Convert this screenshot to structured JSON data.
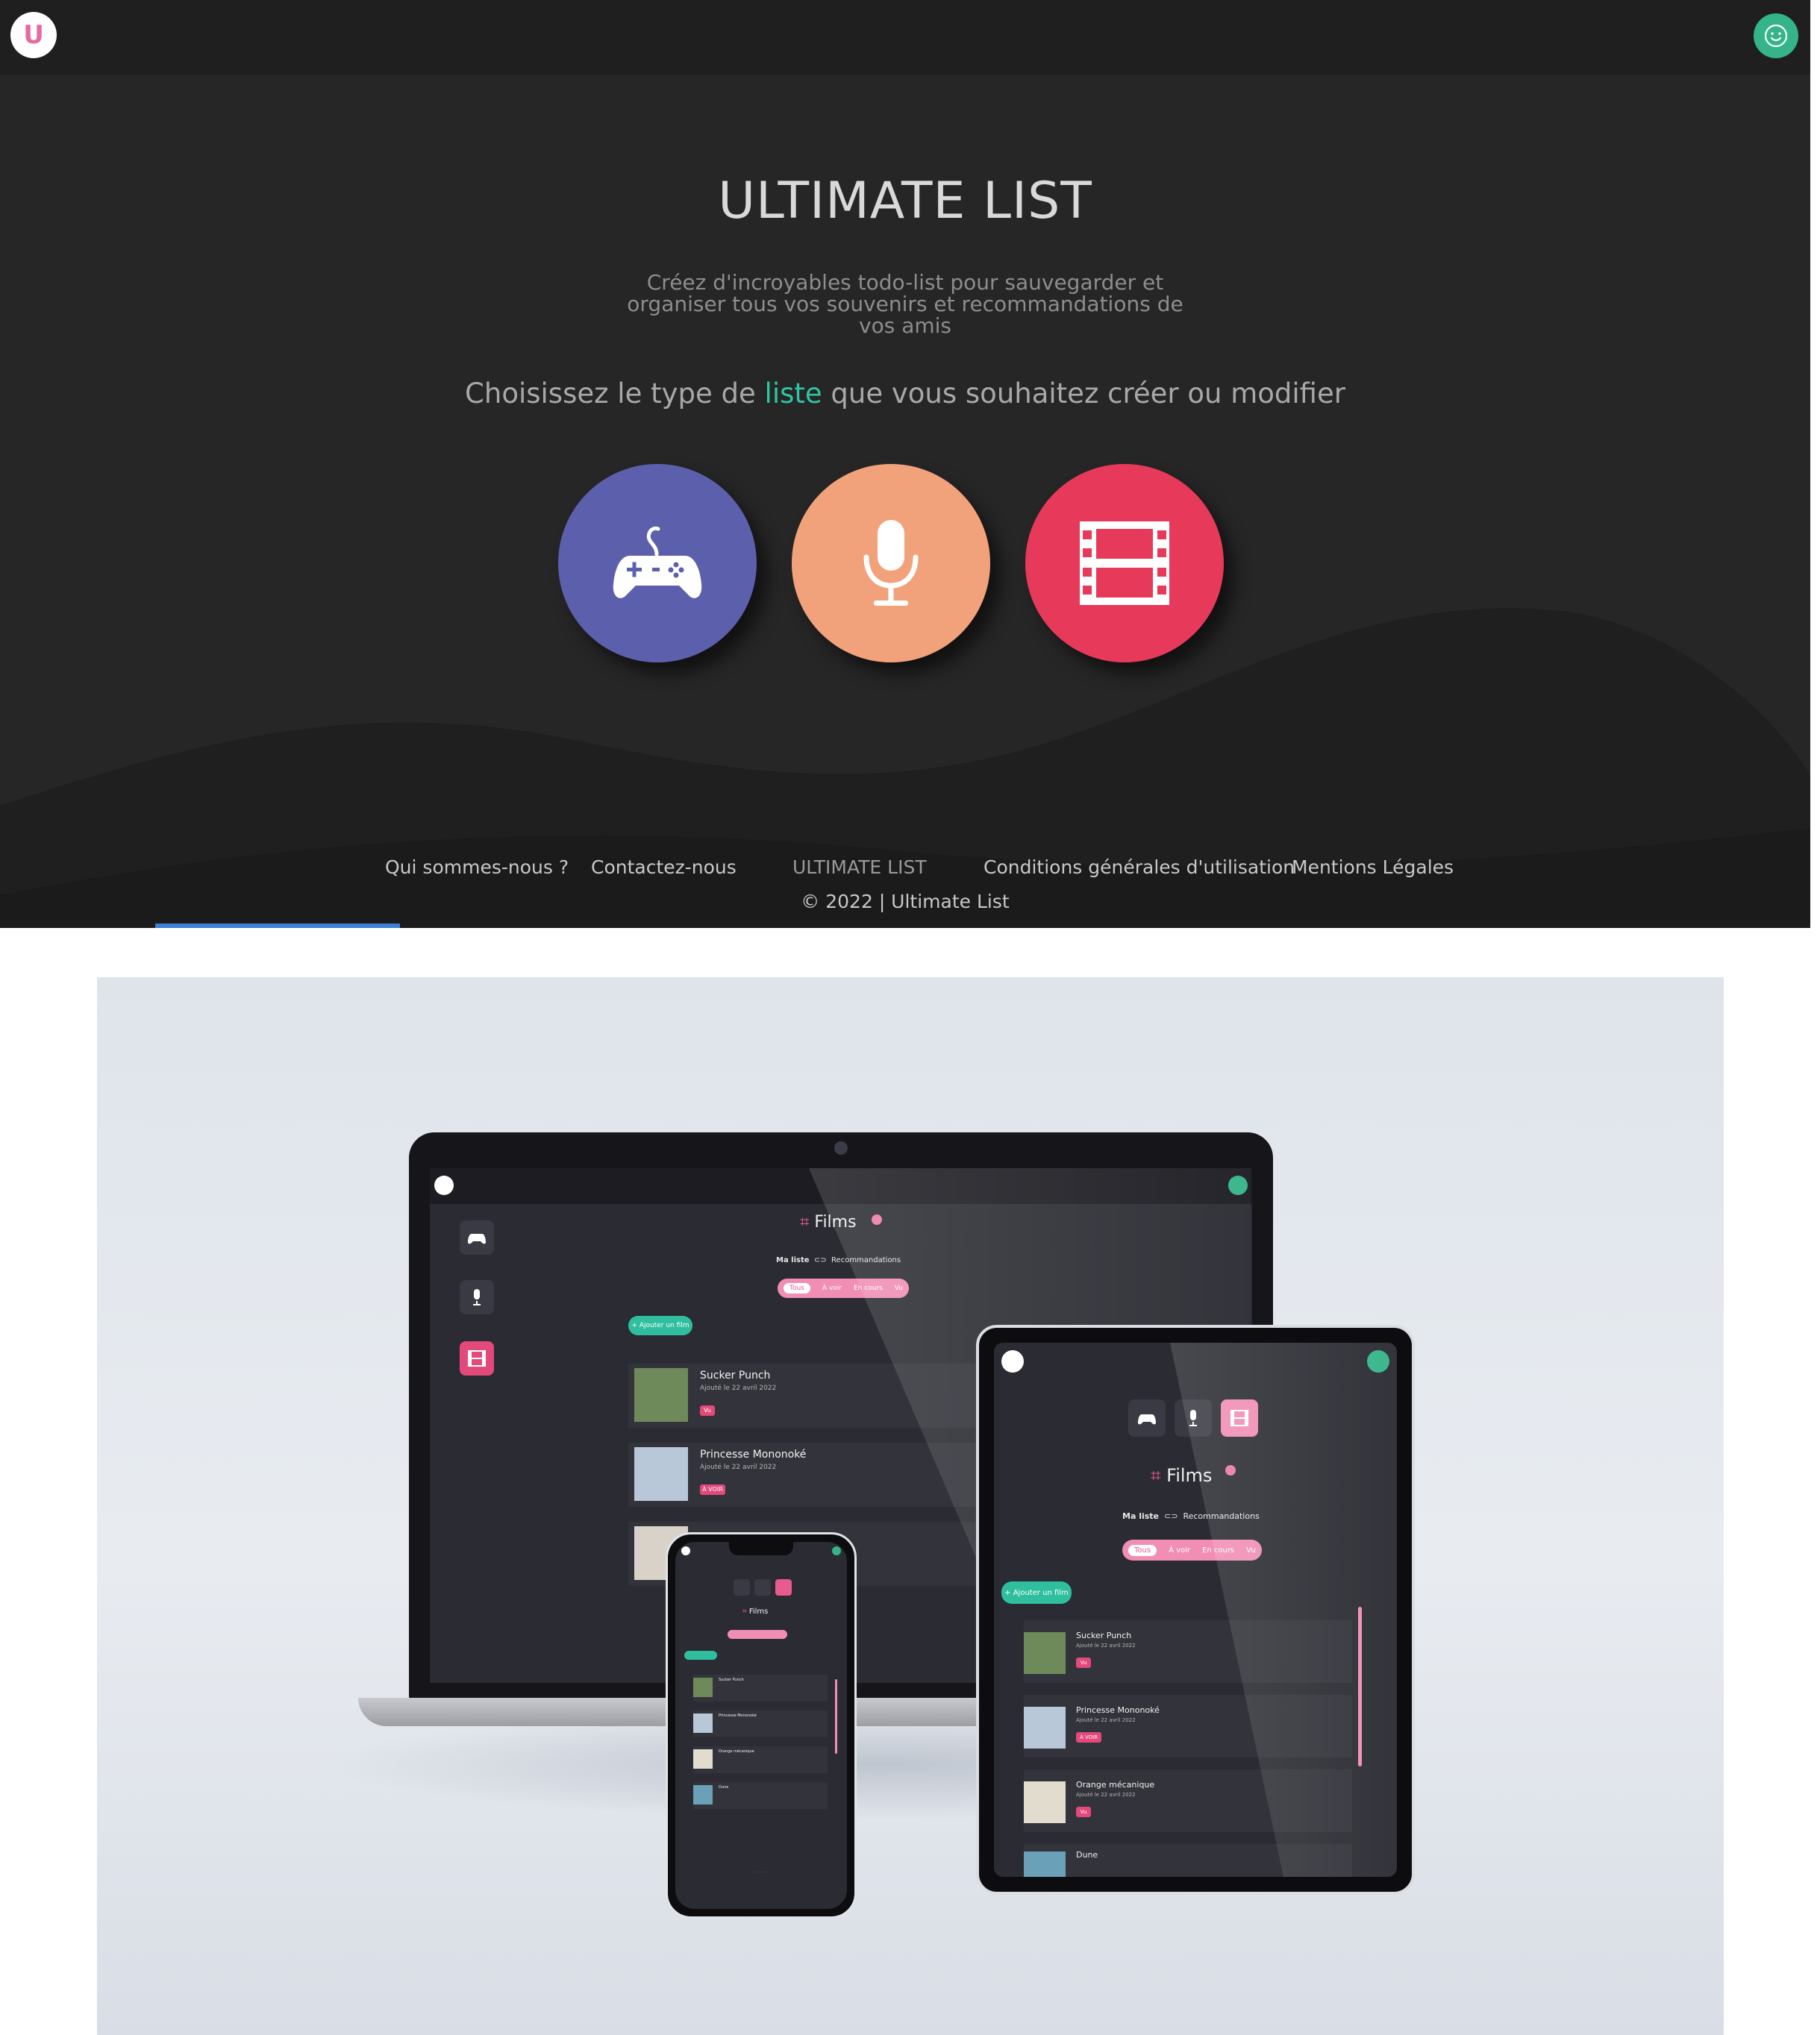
{
  "app": {
    "logo_letter": "U",
    "title": "ULTIMATE LIST",
    "description": "Créez d'incroyables todo-list pour sauvegarder et organiser tous vos souvenirs et recommandations de vos amis",
    "choose_prefix": "Choisissez le type de ",
    "choose_accent": "liste",
    "choose_suffix": " que vous souhaitez créer ou modifier",
    "type_buttons": [
      {
        "name": "gamepad-icon",
        "color": "#5c5fac"
      },
      {
        "name": "microphone-icon",
        "color": "#f2a27b"
      },
      {
        "name": "film-icon",
        "color": "#e73a5b"
      }
    ],
    "footer": {
      "links": [
        "Qui sommes-nous ?",
        "Contactez-nous",
        "ULTIMATE LIST",
        "Conditions générales d'utilisation",
        "Mentions Légales"
      ],
      "copyright": "© 2022 | Ultimate List"
    },
    "colors": {
      "accent": "#2fc5a1",
      "avatar": "#35b48a",
      "background": "#262626"
    }
  },
  "mockup": {
    "laptop": {
      "title": "Films",
      "ma_liste": "Ma liste",
      "recommandations": "Recommandations",
      "tabs": [
        "Tous",
        "À voir",
        "En cours",
        "Vu"
      ],
      "add_button": "+ Ajouter un film",
      "films": [
        {
          "name": "Sucker Punch",
          "date": "Ajouté le 22 avril 2022",
          "status": "Vu"
        },
        {
          "name": "Princesse Mononoké",
          "date": "Ajouté le 22 avril 2022",
          "status": "À VOIR"
        }
      ]
    },
    "tablet": {
      "title": "Films",
      "ma_liste": "Ma liste",
      "recommandations": "Recommandations",
      "tabs": [
        "Tous",
        "À voir",
        "En cours",
        "Vu"
      ],
      "add_button": "+ Ajouter un film",
      "films": [
        {
          "name": "Sucker Punch",
          "date": "Ajouté le 22 avril 2022",
          "status": "Vu"
        },
        {
          "name": "Princesse Mononoké",
          "date": "Ajouté le 22 avril 2022",
          "status": "À VOIR"
        },
        {
          "name": "Orange mécanique",
          "date": "Ajouté le 22 avril 2022",
          "status": "Vu"
        },
        {
          "name": "Dune",
          "date": "",
          "status": ""
        }
      ]
    },
    "phone": {
      "title": "Films",
      "films": [
        "Sucker Punch",
        "Princesse Mononoké",
        "Orange mécanique",
        "Dune"
      ]
    }
  }
}
